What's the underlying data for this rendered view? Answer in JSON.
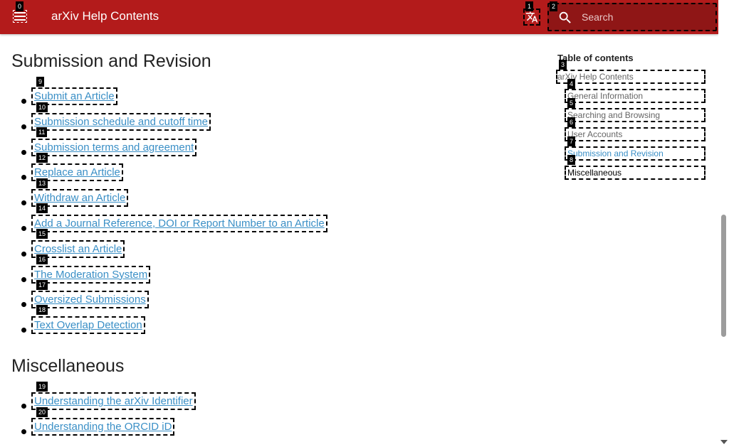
{
  "header": {
    "title": "arXiv Help Contents",
    "search_placeholder": "Search",
    "menu_icon": "menu-icon",
    "language_icon": "translate-icon",
    "search_icon": "search-icon",
    "brand_color": "#b31b1b"
  },
  "tags": {
    "menu": "0",
    "language": "1",
    "search": "2",
    "toc": [
      "3",
      "4",
      "5",
      "6",
      "7",
      "8"
    ],
    "submission": [
      "9",
      "10",
      "11",
      "12",
      "13",
      "14",
      "15",
      "16",
      "17",
      "18"
    ],
    "misc": [
      "19",
      "20"
    ]
  },
  "sections": {
    "submission": {
      "title": "Submission and Revision",
      "links": [
        "Submit an Article",
        "Submission schedule and cutoff time",
        "Submission terms and agreement",
        "Replace an Article",
        "Withdraw an Article",
        "Add a Journal Reference, DOI or Report Number to an Article",
        "Crosslist an Article",
        "The Moderation System",
        "Oversized Submissions",
        "Text Overlap Detection"
      ]
    },
    "misc": {
      "title": "Miscellaneous",
      "links": [
        "Understanding the arXiv Identifier",
        "Understanding the ORCID iD"
      ]
    }
  },
  "toc": {
    "title": "Table of contents",
    "items": [
      "arXiv Help Contents",
      "General Information",
      "Searching and Browsing",
      "User Accounts",
      "Submission and Revision",
      "Miscellaneous"
    ]
  },
  "colors": {
    "link": "#3a8fc6",
    "header_bg": "#b31b1b",
    "search_bg": "#8f1616"
  }
}
